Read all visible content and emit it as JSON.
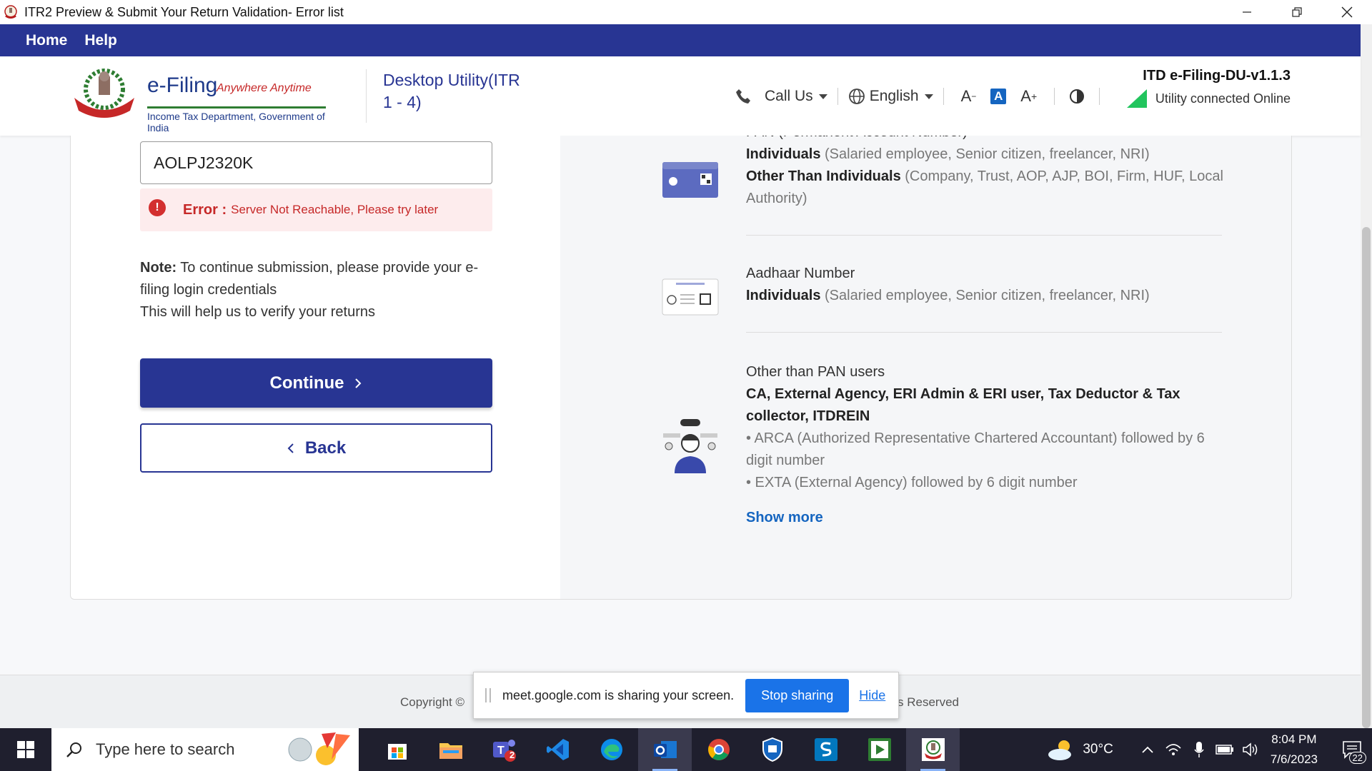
{
  "window": {
    "title": "ITR2 Preview & Submit Your Return Validation- Error list"
  },
  "menu": {
    "home": "Home",
    "help": "Help"
  },
  "header": {
    "logo_main": "e-Filing",
    "logo_tag": "Anywhere Anytime",
    "logo_sub": "Income Tax Department, Government of India",
    "utility_title": "Desktop Utility(ITR 1 - 4)",
    "call_us": "Call Us",
    "language": "English",
    "font_decrease": "A",
    "font_normal": "A",
    "font_increase": "A",
    "version": "ITD e-Filing-DU-v1.1.3",
    "status": "Utility connected Online"
  },
  "form": {
    "pan_value": "AOLPJ2320K",
    "error_label": "Error :",
    "error_message": "Server Not Reachable, Please try later",
    "note_label": "Note:",
    "note_text": " To continue submission, please provide your e-filing login credentials",
    "note_text2": "This will help us to verify your returns",
    "continue_label": "Continue",
    "back_label": "Back"
  },
  "info": {
    "pan_title": "PAN (Permanent Account Number)",
    "pan_ind_bold": "Individuals",
    "pan_ind_muted": " (Salaried employee, Senior citizen, freelancer, NRI)",
    "pan_other_bold": "Other Than Individuals",
    "pan_other_muted": " (Company, Trust, AOP, AJP, BOI, Firm, HUF, Local Authority)",
    "aadhaar_title": "Aadhaar Number",
    "aadhaar_ind_bold": "Individuals",
    "aadhaar_ind_muted": " (Salaried employee, Senior citizen, freelancer, NRI)",
    "other_title": "Other than PAN users",
    "other_bold": "CA, External Agency, ERI Admin & ERI user, Tax Deductor & Tax collector, ITDREIN",
    "other_arca": "• ARCA (Authorized Representative Chartered Accountant) followed by 6 digit number",
    "other_exta": "• EXTA (External Agency) followed by 6 digit number",
    "show_more": "Show more"
  },
  "footer": {
    "copyright_left": "Copyright ©",
    "copyright_right": "s Reserved"
  },
  "share_bar": {
    "message": "meet.google.com is sharing your screen.",
    "stop": "Stop sharing",
    "hide": "Hide"
  },
  "taskbar": {
    "search_placeholder": "Type here to search",
    "temperature": "30°C",
    "time": "8:04 PM",
    "date": "7/6/2023",
    "notifications": "22",
    "teams_badge": "2"
  },
  "colors": {
    "brand_blue": "#283593",
    "error_red": "#c62828",
    "link_blue": "#1565c0",
    "online_green": "#22c55e"
  }
}
